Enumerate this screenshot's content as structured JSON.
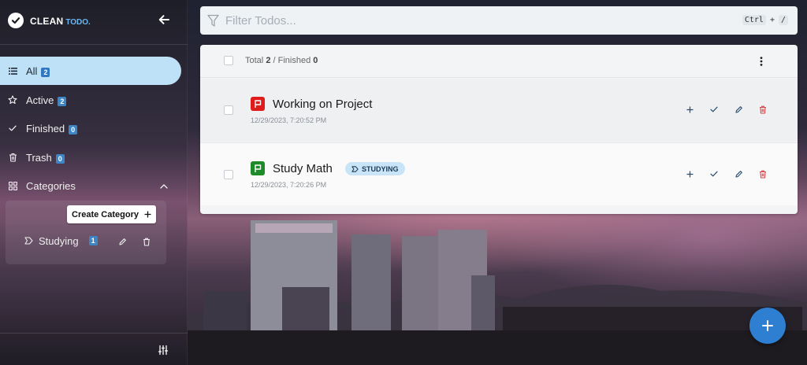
{
  "app": {
    "brand_main": "CLEAN",
    "brand_accent": "TODO.",
    "brand_icon": "check-circle-icon"
  },
  "sidebar": {
    "nav": [
      {
        "label": "All",
        "count": "2",
        "icon": "list-icon",
        "active": true
      },
      {
        "label": "Active",
        "count": "2",
        "icon": "star-icon"
      },
      {
        "label": "Finished",
        "count": "0",
        "icon": "check-icon"
      },
      {
        "label": "Trash",
        "count": "0",
        "icon": "trash-icon"
      }
    ],
    "categories_label": "Categories",
    "create_category_label": "Create Category",
    "categories": [
      {
        "label": "Studying",
        "count": "1",
        "icon": "label-icon"
      }
    ]
  },
  "filter": {
    "placeholder": "Filter Todos...",
    "shortcut_key1": "Ctrl",
    "shortcut_sep": "+",
    "shortcut_key2": "/"
  },
  "stats": {
    "total_label": "Total",
    "total": "2",
    "sep": "/",
    "finished_label": "Finished",
    "finished": "0"
  },
  "todos": [
    {
      "title": "Working on Project",
      "date": "12/29/2023, 7:20:52 PM",
      "priority_color": "#e01b1b"
    },
    {
      "title": "Study Math",
      "date": "12/29/2023, 7:20:26 PM",
      "priority_color": "#1f8a2a",
      "category": "STUDYING"
    }
  ],
  "colors": {
    "accent": "#2e7fd1",
    "active_nav": "#bfe1f7",
    "badge": "#3d86c6",
    "delete": "#d04848"
  }
}
